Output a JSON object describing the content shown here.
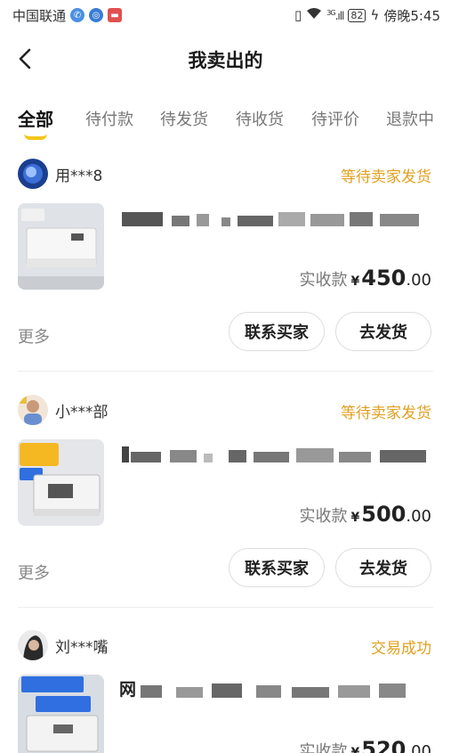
{
  "status_bar": {
    "carrier": "中国联通",
    "time": "傍晚5:45",
    "battery": "82",
    "network": "3G"
  },
  "header": {
    "title": "我卖出的"
  },
  "tabs": [
    {
      "label": "全部",
      "active": true
    },
    {
      "label": "待付款",
      "active": false
    },
    {
      "label": "待发货",
      "active": false
    },
    {
      "label": "待收货",
      "active": false
    },
    {
      "label": "待评价",
      "active": false
    },
    {
      "label": "退款中",
      "active": false
    }
  ],
  "orders": [
    {
      "buyer": "用***8",
      "status": "等待卖家发货",
      "title_prefix": "",
      "price_label": "实收款",
      "currency": "¥",
      "price_int": "450",
      "price_dec": ".00",
      "more": "更多",
      "contact_btn": "联系买家",
      "ship_btn": "去发货"
    },
    {
      "buyer": "小***部",
      "status": "等待卖家发货",
      "title_prefix": "",
      "price_label": "实收款",
      "currency": "¥",
      "price_int": "500",
      "price_dec": ".00",
      "more": "更多",
      "contact_btn": "联系买家",
      "ship_btn": "去发货"
    },
    {
      "buyer": "刘***嘴",
      "status": "交易成功",
      "title_prefix": "网",
      "price_label": "实收款",
      "currency": "¥",
      "price_int": "520",
      "price_dec": ".00"
    }
  ],
  "colors": {
    "accent": "#f5c518",
    "status": "#e0a020"
  }
}
